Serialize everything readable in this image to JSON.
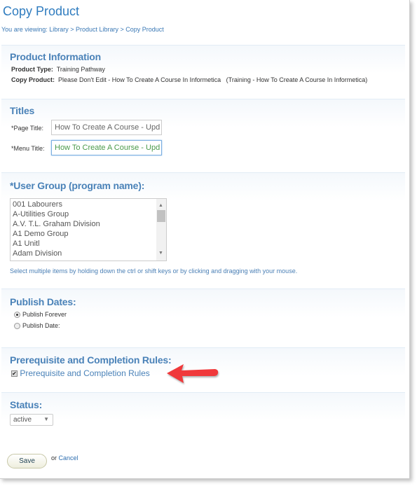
{
  "header": {
    "title": "Copy Product",
    "breadcrumb": "You are viewing: Library > Product Library > Copy Product"
  },
  "product_info": {
    "heading": "Product Information",
    "type_label": "Product Type:",
    "type_value": "Training Pathway",
    "copy_label": "Copy Product:",
    "copy_value": "Please Don't Edit - How To Create A Course In Informetica   (Training - How To Create A Course In Informetica)"
  },
  "titles": {
    "heading": "Titles",
    "page_label": "*Page Title:",
    "page_value": "How To Create A Course - Upd",
    "menu_label": "*Menu Title:",
    "menu_value": "How To Create A Course - Upd"
  },
  "user_group": {
    "heading": "*User Group (program name):",
    "items": [
      "001 Labourers",
      "A-Utilities Group",
      "A.V. T.L. Graham Division",
      "A1 Demo Group",
      "A1 Unitl",
      "Adam Division"
    ],
    "hint": "Select multiple items by holding down the ctrl or shift keys or by clicking and dragging with your mouse."
  },
  "publish": {
    "heading": "Publish Dates:",
    "options": [
      {
        "label": "Publish Forever",
        "selected": true
      },
      {
        "label": "Publish Date:",
        "selected": false
      }
    ]
  },
  "prereq": {
    "heading": "Prerequisite and Completion Rules:",
    "checkbox_label": "Prerequisite and Completion Rules",
    "checked": true,
    "annotation_color": "#f0393b"
  },
  "status": {
    "heading": "Status:",
    "value": "active"
  },
  "actions": {
    "save": "Save",
    "or": "or",
    "cancel": "Cancel"
  }
}
